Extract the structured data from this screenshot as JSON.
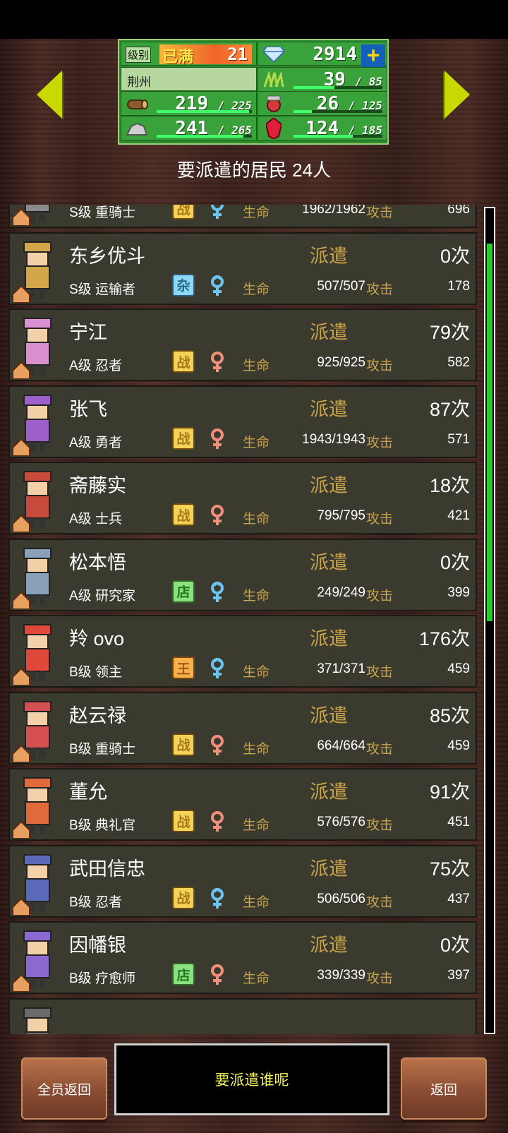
{
  "town": {
    "level_label": "级别",
    "level_maxed": "已满",
    "level": "21",
    "gems": "2914",
    "city_name": "荆州",
    "resources": [
      {
        "name": "grass",
        "value": "39",
        "max": "85",
        "fill": 0.46
      },
      {
        "name": "wood",
        "value": "219",
        "max": "225",
        "fill": 0.97
      },
      {
        "name": "food",
        "value": "26",
        "max": "125",
        "fill": 0.21
      },
      {
        "name": "stone",
        "value": "241",
        "max": "265",
        "fill": 0.91
      },
      {
        "name": "ruby",
        "value": "124",
        "max": "185",
        "fill": 0.67
      }
    ]
  },
  "header": {
    "title": "要派遣的居民 24人"
  },
  "labels": {
    "dispatch": "派遣",
    "life": "生命",
    "attack": "攻击"
  },
  "residents": [
    {
      "name": "",
      "rank": "S级 重骑士",
      "tag": "战",
      "tag_type": "war",
      "gender": "male",
      "life": "1962/1962",
      "attack": "696",
      "count": "",
      "color": "#8a8a8a"
    },
    {
      "name": "东乡优斗",
      "rank": "S级 运输者",
      "tag": "杂",
      "tag_type": "misc",
      "gender": "male",
      "life": "507/507",
      "attack": "178",
      "count": "0次",
      "color": "#d4a64a"
    },
    {
      "name": "宁江",
      "rank": "A级 忍者",
      "tag": "战",
      "tag_type": "war",
      "gender": "female",
      "life": "925/925",
      "attack": "582",
      "count": "79次",
      "color": "#d98fd0"
    },
    {
      "name": "张飞",
      "rank": "A级 勇者",
      "tag": "战",
      "tag_type": "war",
      "gender": "female",
      "life": "1943/1943",
      "attack": "571",
      "count": "87次",
      "color": "#9d5fc9"
    },
    {
      "name": "斋藤实",
      "rank": "A级 士兵",
      "tag": "战",
      "tag_type": "war",
      "gender": "female",
      "life": "795/795",
      "attack": "421",
      "count": "18次",
      "color": "#c84a3a"
    },
    {
      "name": "松本悟",
      "rank": "A级 研究家",
      "tag": "店",
      "tag_type": "shop",
      "gender": "male",
      "life": "249/249",
      "attack": "399",
      "count": "0次",
      "color": "#8aa0b8"
    },
    {
      "name": "羚 ovo",
      "rank": "B级 领主",
      "tag": "王",
      "tag_type": "king",
      "gender": "male",
      "life": "371/371",
      "attack": "459",
      "count": "176次",
      "color": "#e0483a"
    },
    {
      "name": "赵云禄",
      "rank": "B级 重骑士",
      "tag": "战",
      "tag_type": "war",
      "gender": "female",
      "life": "664/664",
      "attack": "459",
      "count": "85次",
      "color": "#d45050"
    },
    {
      "name": "董允",
      "rank": "B级 典礼官",
      "tag": "战",
      "tag_type": "war",
      "gender": "female",
      "life": "576/576",
      "attack": "451",
      "count": "91次",
      "color": "#e06a3a"
    },
    {
      "name": "武田信忠",
      "rank": "B级 忍者",
      "tag": "战",
      "tag_type": "war",
      "gender": "male",
      "life": "506/506",
      "attack": "437",
      "count": "75次",
      "color": "#5a6ab8"
    },
    {
      "name": "因幡银",
      "rank": "B级 疗愈师",
      "tag": "店",
      "tag_type": "shop",
      "gender": "female",
      "life": "339/339",
      "attack": "397",
      "count": "0次",
      "color": "#8a6ad0"
    },
    {
      "name": "",
      "rank": "",
      "tag": "",
      "tag_type": "war",
      "gender": "male",
      "life": "",
      "attack": "",
      "count": "",
      "color": "#6a6a6a"
    }
  ],
  "scroll": {
    "thumb_fraction": 0.46
  },
  "footer": {
    "recall_all": "全员返回",
    "prompt": "要派遣谁呢",
    "back": "返回"
  },
  "colors": {
    "accent_gold": "#c7a24a",
    "panel": "#3b3a2f",
    "scroll_thumb": "#23d02a",
    "arrow": "#c9d800"
  }
}
